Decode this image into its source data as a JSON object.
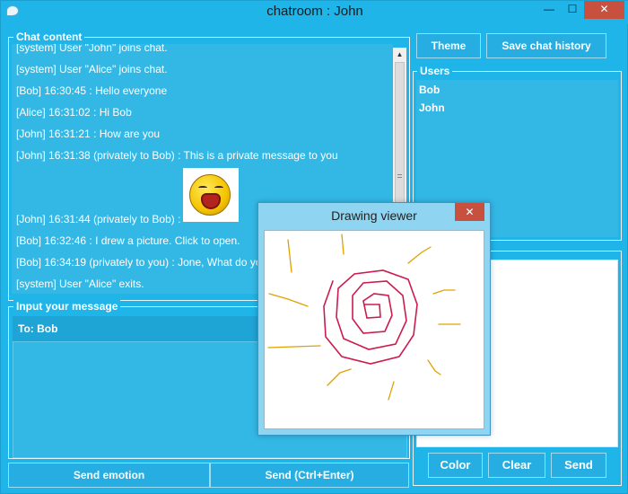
{
  "window": {
    "title": "chatroom : John",
    "min_glyph": "—",
    "max_glyph": "☐",
    "close_glyph": "✕"
  },
  "chat": {
    "legend": "Chat content",
    "messages": [
      "[system] User \"John\" joins chat.",
      "[system] User \"Alice\" joins chat.",
      "[Bob] 16:30:45 : Hello everyone",
      "[Alice] 16:31:02 : Hi Bob",
      "[John] 16:31:21 : How are you",
      "[John] 16:31:38 (privately to Bob) : This is a private message to you",
      "[John] 16:31:44 (privately to Bob) :",
      "[Bob] 16:32:46 : I drew a picture. Click to open.",
      "[Bob] 16:34:19 (privately to you) : Jone, What do you",
      "[system] User \"Alice\" exits."
    ],
    "emoji_icon": "laughing-emoji-icon"
  },
  "input": {
    "legend": "Input your message",
    "to_text": "To: Bob",
    "value": ""
  },
  "toolbar": {
    "theme_label": "Theme",
    "save_label": "Save chat history"
  },
  "users": {
    "legend": "Users",
    "items": [
      "Bob",
      "John"
    ]
  },
  "bottom": {
    "emotion_label": "Send emotion",
    "send_main_label": "Send (Ctrl+Enter)",
    "color_label": "Color",
    "clear_label": "Clear",
    "send_label": "Send"
  },
  "viewer": {
    "title": "Drawing viewer",
    "close_glyph": "✕"
  },
  "colors": {
    "background": "#1fb5e8",
    "close_button": "#c7503f",
    "spiral_stroke": "#cc1b4e",
    "ray_stroke": "#e0a100"
  }
}
